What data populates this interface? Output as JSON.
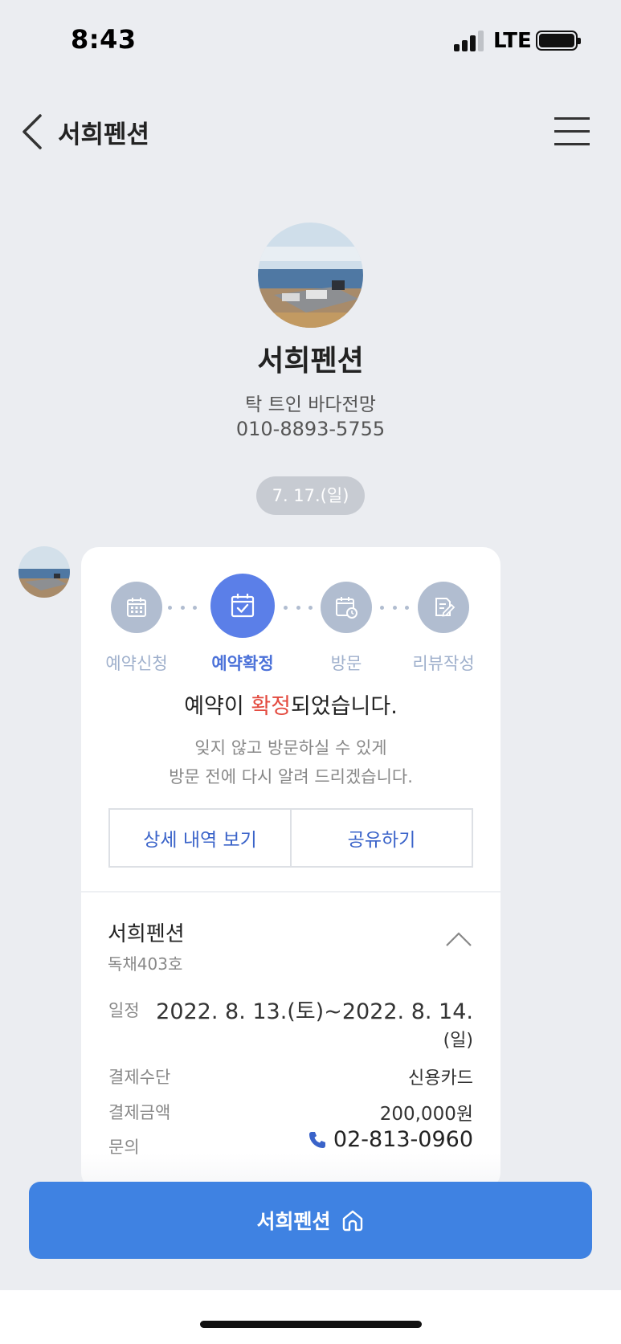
{
  "status_bar": {
    "time": "8:43",
    "network": "LTE"
  },
  "header": {
    "title": "서희펜션"
  },
  "profile": {
    "name": "서희펜션",
    "description": "탁 트인 바다전망",
    "phone": "010-8893-5755"
  },
  "date_chip": "7. 17.(일)",
  "steps": [
    {
      "label": "예약신청",
      "icon": "calendar-icon",
      "active": false
    },
    {
      "label": "예약확정",
      "icon": "calendar-check-icon",
      "active": true
    },
    {
      "label": "방문",
      "icon": "calendar-clock-icon",
      "active": false
    },
    {
      "label": "리뷰작성",
      "icon": "edit-icon",
      "active": false
    }
  ],
  "message": {
    "main_prefix": "예약이 ",
    "main_highlight": "확정",
    "main_suffix": "되었습니다.",
    "sub_line1": "잊지 않고 방문하실 수 있게",
    "sub_line2": "방문 전에 다시 알려 드리겠습니다."
  },
  "buttons": {
    "details": "상세 내역 보기",
    "share": "공유하기"
  },
  "reservation": {
    "title": "서희펜션",
    "room": "독채403호",
    "schedule_label": "일정",
    "schedule_value_line1": "2022. 8. 13.(토)~2022. 8. 14.",
    "schedule_value_line2": "(일)",
    "payment_method_label": "결제수단",
    "payment_method_value": "신용카드",
    "payment_amount_label": "결제금액",
    "payment_amount_value": "200,000원",
    "inquiry_label": "문의",
    "inquiry_phone": "02-813-0960"
  },
  "bottom_button": {
    "label": "서희펜션"
  },
  "colors": {
    "accent": "#5b7fe8",
    "highlight": "#e34a3f",
    "bottom_button": "#3f82e2",
    "background": "#ebedf1"
  }
}
